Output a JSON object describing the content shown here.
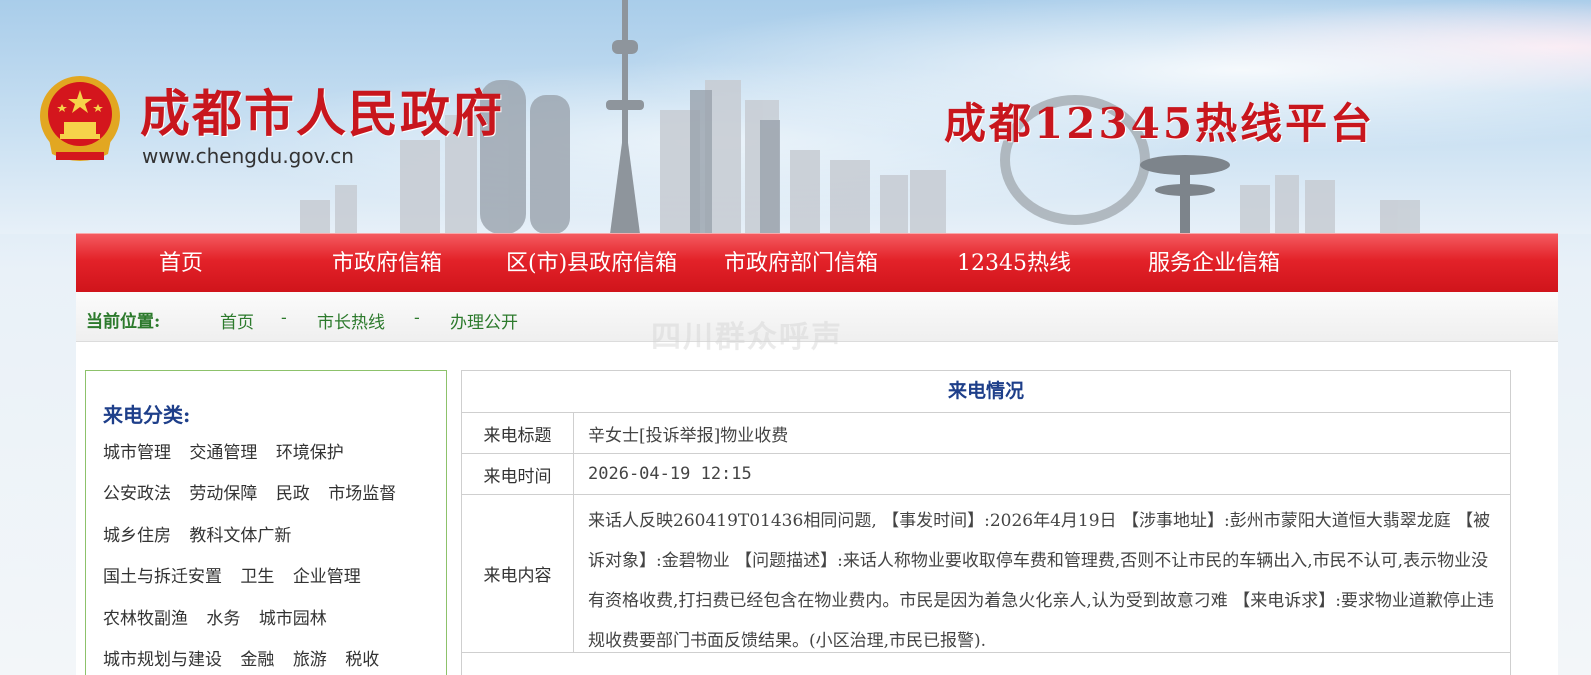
{
  "header": {
    "gov_title": "成都市人民政府",
    "gov_url": "www.chengdu.gov.cn",
    "hotline_title": "成都12345热线平台"
  },
  "nav": {
    "items": [
      {
        "label": "首页"
      },
      {
        "label": "市政府信箱"
      },
      {
        "label": "区(市)县政府信箱"
      },
      {
        "label": "市政府部门信箱"
      },
      {
        "label": "12345热线"
      },
      {
        "label": "服务企业信箱"
      }
    ]
  },
  "breadcrumb": {
    "label": "当前位置:",
    "items": [
      "首页",
      "市长热线",
      "办理公开"
    ],
    "separator": "-"
  },
  "watermark": "四川群众呼声",
  "sidebar": {
    "title": "来电分类:",
    "rows": [
      [
        "城市管理",
        "交通管理",
        "环境保护"
      ],
      [
        "公安政法",
        "劳动保障",
        "民政",
        "市场监督"
      ],
      [
        "城乡住房",
        "教科文体广新"
      ],
      [
        "国土与拆迁安置",
        "卫生",
        "企业管理"
      ],
      [
        "农林牧副渔",
        "水务",
        "城市园林"
      ],
      [
        "城市规划与建设",
        "金融",
        "旅游",
        "税收"
      ]
    ]
  },
  "call": {
    "heading": "来电情况",
    "title_label": "来电标题",
    "title_value": "辛女士[投诉举报]物业收费",
    "time_label": "来电时间",
    "time_value": "2026-04-19 12:15",
    "content_label": "来电内容",
    "content_value": "来话人反映260419T01436相同问题, 【事发时间】:2026年4月19日 【涉事地址】:彭州市蒙阳大道恒大翡翠龙庭 【被诉对象】:金碧物业 【问题描述】:来话人称物业要收取停车费和管理费,否则不让市民的车辆出入,市民不认可,表示物业没有资格收费,打扫费已经包含在物业费内。市民是因为着急火化亲人,认为受到故意刁难 【来电诉求】:要求物业道歉停止违规收费要部门书面反馈结果。(小区治理,市民已报警)."
  },
  "colors": {
    "brand_red": "#c8161d",
    "nav_red": "#e32229",
    "link_green": "#2c7a2c",
    "heading_blue": "#1e3f8a",
    "sidebar_border": "#8dc26b"
  }
}
